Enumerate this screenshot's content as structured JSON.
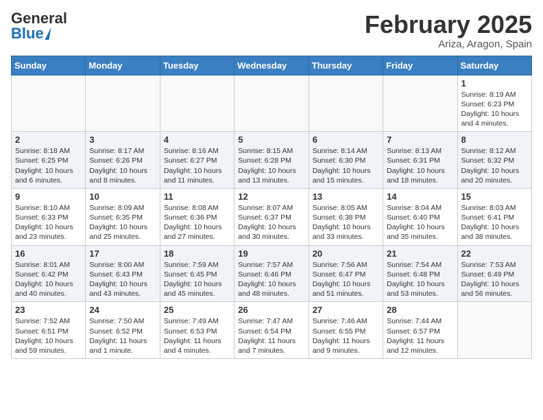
{
  "header": {
    "logo_general": "General",
    "logo_blue": "Blue",
    "title": "February 2025",
    "subtitle": "Ariza, Aragon, Spain"
  },
  "weekdays": [
    "Sunday",
    "Monday",
    "Tuesday",
    "Wednesday",
    "Thursday",
    "Friday",
    "Saturday"
  ],
  "weeks": [
    [
      {
        "day": "",
        "info": ""
      },
      {
        "day": "",
        "info": ""
      },
      {
        "day": "",
        "info": ""
      },
      {
        "day": "",
        "info": ""
      },
      {
        "day": "",
        "info": ""
      },
      {
        "day": "",
        "info": ""
      },
      {
        "day": "1",
        "info": "Sunrise: 8:19 AM\nSunset: 6:23 PM\nDaylight: 10 hours\nand 4 minutes."
      }
    ],
    [
      {
        "day": "2",
        "info": "Sunrise: 8:18 AM\nSunset: 6:25 PM\nDaylight: 10 hours\nand 6 minutes."
      },
      {
        "day": "3",
        "info": "Sunrise: 8:17 AM\nSunset: 6:26 PM\nDaylight: 10 hours\nand 8 minutes."
      },
      {
        "day": "4",
        "info": "Sunrise: 8:16 AM\nSunset: 6:27 PM\nDaylight: 10 hours\nand 11 minutes."
      },
      {
        "day": "5",
        "info": "Sunrise: 8:15 AM\nSunset: 6:28 PM\nDaylight: 10 hours\nand 13 minutes."
      },
      {
        "day": "6",
        "info": "Sunrise: 8:14 AM\nSunset: 6:30 PM\nDaylight: 10 hours\nand 15 minutes."
      },
      {
        "day": "7",
        "info": "Sunrise: 8:13 AM\nSunset: 6:31 PM\nDaylight: 10 hours\nand 18 minutes."
      },
      {
        "day": "8",
        "info": "Sunrise: 8:12 AM\nSunset: 6:32 PM\nDaylight: 10 hours\nand 20 minutes."
      }
    ],
    [
      {
        "day": "9",
        "info": "Sunrise: 8:10 AM\nSunset: 6:33 PM\nDaylight: 10 hours\nand 23 minutes."
      },
      {
        "day": "10",
        "info": "Sunrise: 8:09 AM\nSunset: 6:35 PM\nDaylight: 10 hours\nand 25 minutes."
      },
      {
        "day": "11",
        "info": "Sunrise: 8:08 AM\nSunset: 6:36 PM\nDaylight: 10 hours\nand 27 minutes."
      },
      {
        "day": "12",
        "info": "Sunrise: 8:07 AM\nSunset: 6:37 PM\nDaylight: 10 hours\nand 30 minutes."
      },
      {
        "day": "13",
        "info": "Sunrise: 8:05 AM\nSunset: 6:38 PM\nDaylight: 10 hours\nand 33 minutes."
      },
      {
        "day": "14",
        "info": "Sunrise: 8:04 AM\nSunset: 6:40 PM\nDaylight: 10 hours\nand 35 minutes."
      },
      {
        "day": "15",
        "info": "Sunrise: 8:03 AM\nSunset: 6:41 PM\nDaylight: 10 hours\nand 38 minutes."
      }
    ],
    [
      {
        "day": "16",
        "info": "Sunrise: 8:01 AM\nSunset: 6:42 PM\nDaylight: 10 hours\nand 40 minutes."
      },
      {
        "day": "17",
        "info": "Sunrise: 8:00 AM\nSunset: 6:43 PM\nDaylight: 10 hours\nand 43 minutes."
      },
      {
        "day": "18",
        "info": "Sunrise: 7:59 AM\nSunset: 6:45 PM\nDaylight: 10 hours\nand 45 minutes."
      },
      {
        "day": "19",
        "info": "Sunrise: 7:57 AM\nSunset: 6:46 PM\nDaylight: 10 hours\nand 48 minutes."
      },
      {
        "day": "20",
        "info": "Sunrise: 7:56 AM\nSunset: 6:47 PM\nDaylight: 10 hours\nand 51 minutes."
      },
      {
        "day": "21",
        "info": "Sunrise: 7:54 AM\nSunset: 6:48 PM\nDaylight: 10 hours\nand 53 minutes."
      },
      {
        "day": "22",
        "info": "Sunrise: 7:53 AM\nSunset: 6:49 PM\nDaylight: 10 hours\nand 56 minutes."
      }
    ],
    [
      {
        "day": "23",
        "info": "Sunrise: 7:52 AM\nSunset: 6:51 PM\nDaylight: 10 hours\nand 59 minutes."
      },
      {
        "day": "24",
        "info": "Sunrise: 7:50 AM\nSunset: 6:52 PM\nDaylight: 11 hours\nand 1 minute."
      },
      {
        "day": "25",
        "info": "Sunrise: 7:49 AM\nSunset: 6:53 PM\nDaylight: 11 hours\nand 4 minutes."
      },
      {
        "day": "26",
        "info": "Sunrise: 7:47 AM\nSunset: 6:54 PM\nDaylight: 11 hours\nand 7 minutes."
      },
      {
        "day": "27",
        "info": "Sunrise: 7:46 AM\nSunset: 6:55 PM\nDaylight: 11 hours\nand 9 minutes."
      },
      {
        "day": "28",
        "info": "Sunrise: 7:44 AM\nSunset: 6:57 PM\nDaylight: 11 hours\nand 12 minutes."
      },
      {
        "day": "",
        "info": ""
      }
    ]
  ]
}
